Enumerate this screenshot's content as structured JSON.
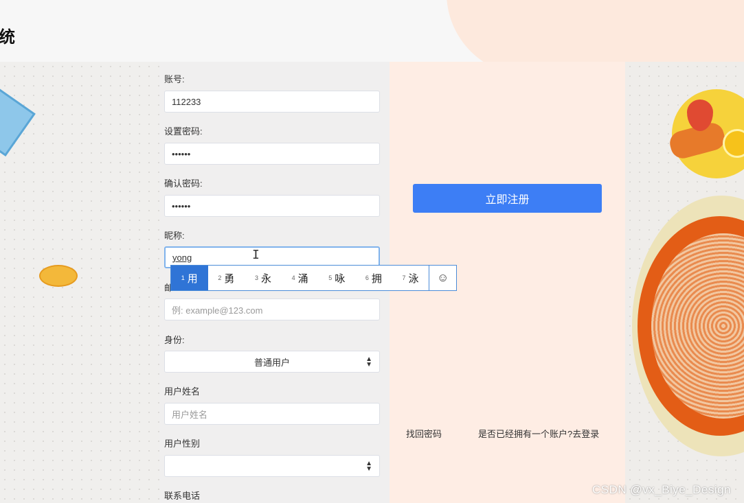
{
  "header": {
    "title": "统"
  },
  "form": {
    "account_label": "账号:",
    "account_value": "112233",
    "password_label": "设置密码:",
    "password_value": "••••••",
    "confirm_label": "确认密码:",
    "confirm_value": "••••••",
    "nickname_label": "昵称:",
    "nickname_value": "yong",
    "email_label_partial": "邮",
    "email_placeholder": "例: example@123.com",
    "identity_label": "身份:",
    "identity_selected": "普通用户",
    "realname_label": "用户姓名",
    "realname_placeholder": "用户姓名",
    "gender_label": "用户性别",
    "gender_selected": "",
    "phone_label": "联系电话"
  },
  "actions": {
    "register_label": "立即注册",
    "recover_link": "找回密码",
    "login_link": "是否已经拥有一个账户?去登录"
  },
  "ime": {
    "candidates": [
      {
        "num": "1",
        "char": "用"
      },
      {
        "num": "2",
        "char": "勇"
      },
      {
        "num": "3",
        "char": "永"
      },
      {
        "num": "4",
        "char": "涌"
      },
      {
        "num": "5",
        "char": "咏"
      },
      {
        "num": "6",
        "char": "拥"
      },
      {
        "num": "7",
        "char": "泳"
      }
    ],
    "selected_index": 0,
    "emoji_glyph": "☺"
  },
  "watermark": "CSDN @vx_Biye_Design",
  "colors": {
    "primary": "#3d7ef5",
    "right_panel": "#feede4",
    "ime_select": "#2f74d6"
  }
}
